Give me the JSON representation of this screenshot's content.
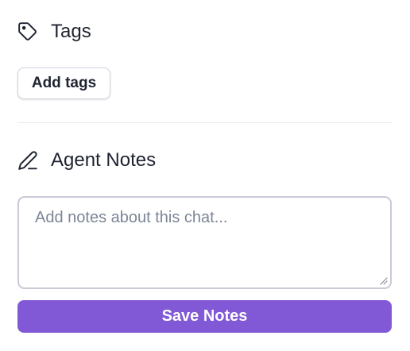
{
  "tags": {
    "icon": "tag-icon",
    "title": "Tags",
    "add_button_label": "Add tags"
  },
  "notes": {
    "icon": "pencil-icon",
    "title": "Agent Notes",
    "placeholder": "Add notes about this chat...",
    "value": "",
    "save_button_label": "Save Notes"
  },
  "colors": {
    "accent": "#8158d6",
    "text": "#1f2330",
    "placeholder": "#7d8596",
    "border": "#c9cad6"
  }
}
